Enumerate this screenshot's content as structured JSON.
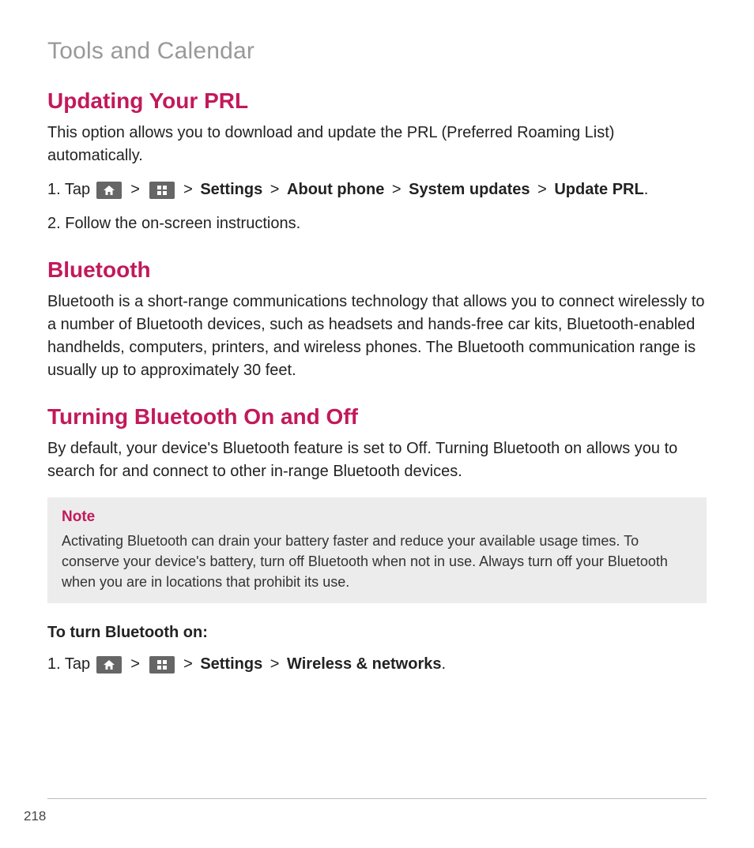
{
  "chapter": "Tools and Calendar",
  "pageNumber": "218",
  "sections": {
    "prl": {
      "heading": "Updating Your PRL",
      "intro": "This option allows you to download and update the PRL (Preferred Roaming List) automatically.",
      "step1_prefix": "1. Tap ",
      "step1_sep": " > ",
      "step1_path_settings": "Settings",
      "step1_path_about": "About phone",
      "step1_path_system": "System updates",
      "step1_path_update": "Update PRL",
      "step1_period": ".",
      "step2": "2. Follow the on-screen instructions."
    },
    "bt": {
      "heading": "Bluetooth",
      "body": "Bluetooth is a short-range communications technology that allows you to connect wirelessly to a number of Bluetooth devices, such as headsets and hands-free car kits, Bluetooth-enabled handhelds, computers, printers, and wireless phones. The Bluetooth communication range is usually up to approximately 30 feet."
    },
    "btToggle": {
      "heading": "Turning Bluetooth On and Off",
      "body": "By default, your device's Bluetooth feature is set to Off. Turning Bluetooth on allows you to search for and connect to other in-range Bluetooth devices.",
      "noteLabel": "Note",
      "noteText": "Activating Bluetooth can drain your battery faster and reduce your available usage times. To conserve your device's battery, turn off Bluetooth when not in use. Always turn off your Bluetooth when you are in locations that prohibit its use.",
      "subHeading": "To turn Bluetooth on:",
      "step1_prefix": "1. Tap ",
      "step1_sep": " > ",
      "step1_path_settings": "Settings",
      "step1_path_wireless": "Wireless & networks",
      "step1_period": "."
    }
  }
}
